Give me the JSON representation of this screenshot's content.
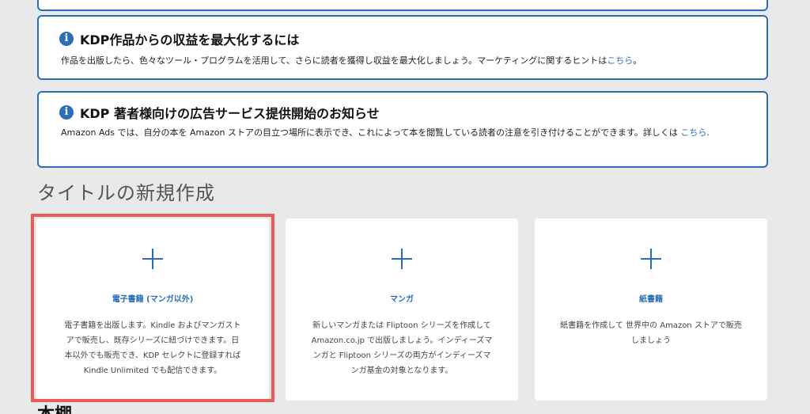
{
  "alerts": [
    {
      "title": "KDP作品からの収益を最大化するには",
      "body": "作品を出版したら、色々なツール・プログラムを活用して、さらに読者を獲得し収益を最大化しましょう。マーケティングに関するヒントは",
      "link": "こちら",
      "suffix": "。"
    },
    {
      "title": "KDP 著者様向けの広告サービス提供開始のお知らせ",
      "body": "Amazon Ads では、自分の本を Amazon ストアの目立つ場所に表示でき、これによって本を閲覧している読者の注意を引き付けることができます。詳しくは ",
      "link": "こちら",
      "suffix": "."
    }
  ],
  "section_title": "タイトルの新規作成",
  "cards": [
    {
      "title": "電子書籍 (マンガ以外)",
      "desc_lines": [
        "電子書籍を出版します。Kindle およびマンガスト",
        "アで販売し、既存シリーズに紐づけできます。日",
        "本以外でも販売でき、KDP セレクトに登録すれば",
        "Kindle Unlimited でも配信できます。"
      ]
    },
    {
      "title": "マンガ",
      "desc_lines": [
        "新しいマンガまたは Fliptoon シリーズを作成して",
        "Amazon.co.jp で出版しましょう。インディーズマ",
        "ンガと Fliptoon シリーズの両方がインディーズマ",
        "ンガ基金の対象となります。"
      ]
    },
    {
      "title": "紙書籍",
      "desc_lines": [
        "紙書籍を作成して 世界中の Amazon ストアで販売",
        "しましょう"
      ]
    }
  ],
  "bottom_heading": "本棚",
  "colors": {
    "accent": "#2a6ebb",
    "highlight": "#ec5a5a",
    "background": "#e9e9e9"
  },
  "icons": {
    "info": "info-icon",
    "plus": "plus-icon"
  }
}
